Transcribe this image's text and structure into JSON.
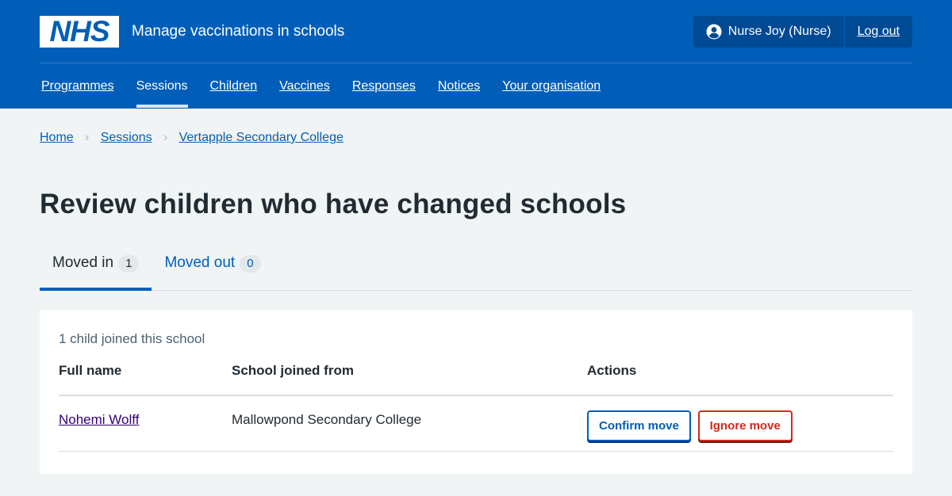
{
  "header": {
    "logo_text": "NHS",
    "service_name": "Manage vaccinations in schools",
    "user_label": "Nurse Joy (Nurse)",
    "logout_label": "Log out"
  },
  "nav": {
    "items": [
      {
        "label": "Programmes"
      },
      {
        "label": "Sessions"
      },
      {
        "label": "Children"
      },
      {
        "label": "Vaccines"
      },
      {
        "label": "Responses"
      },
      {
        "label": "Notices"
      },
      {
        "label": "Your organisation"
      }
    ],
    "current": "Sessions"
  },
  "breadcrumb": {
    "items": [
      {
        "label": "Home"
      },
      {
        "label": "Sessions"
      },
      {
        "label": "Vertapple Secondary College"
      }
    ],
    "separator": "›"
  },
  "page": {
    "title": "Review children who have changed schools"
  },
  "tabs": [
    {
      "label": "Moved in",
      "count": "1"
    },
    {
      "label": "Moved out",
      "count": "0"
    }
  ],
  "card": {
    "caption": "1 child joined this school",
    "columns": [
      "Full name",
      "School joined from",
      "Actions"
    ],
    "rows": [
      {
        "full_name": "Nohemi Wolff",
        "school_from": "Mallowpond Secondary College",
        "confirm_label": "Confirm move",
        "ignore_label": "Ignore move"
      }
    ]
  },
  "colors": {
    "brand_blue": "#005eb8",
    "dark_blue": "#004a94",
    "page_bg": "#f0f4f5",
    "danger_red": "#d5281b",
    "visited_link": "#330072"
  }
}
